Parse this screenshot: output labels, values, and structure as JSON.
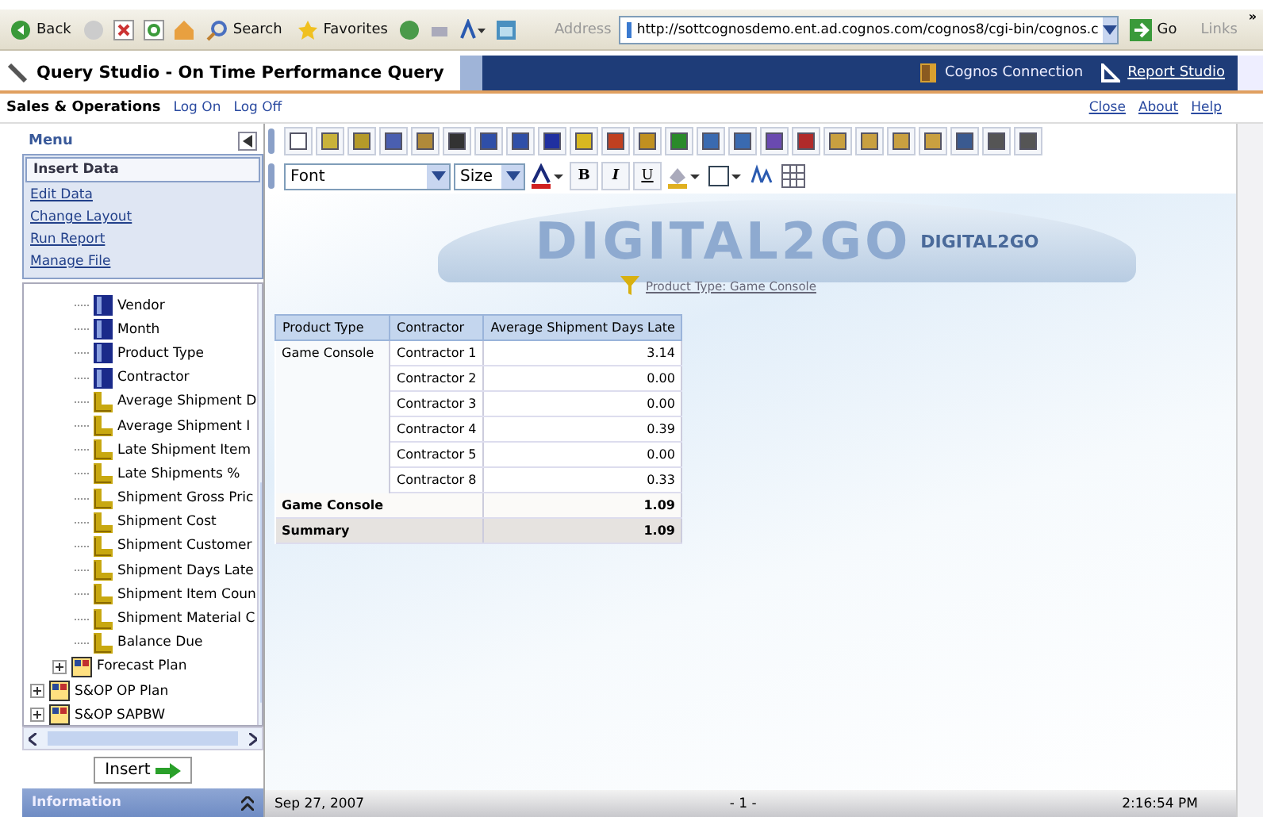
{
  "browser": {
    "back": "Back",
    "search": "Search",
    "favorites": "Favorites",
    "address_label": "Address",
    "url": "http://sottcognosdemo.ent.ad.cognos.com/cognos8/cgi-bin/cognos.c",
    "go": "Go",
    "links": "Links",
    "more": "»"
  },
  "app_bar": {
    "title": "Query Studio - On Time Performance Query",
    "cognos_connection": "Cognos Connection",
    "report_studio": "Report Studio"
  },
  "sub_bar": {
    "package": "Sales & Operations",
    "log_on": "Log On",
    "log_off": "Log Off",
    "links": [
      "Close",
      "About",
      "Help"
    ]
  },
  "menu": {
    "title": "Menu",
    "items": [
      {
        "label": "Insert Data",
        "selected": true
      },
      {
        "label": "Edit Data",
        "selected": false
      },
      {
        "label": "Change Layout",
        "selected": false
      },
      {
        "label": "Run Report",
        "selected": false
      },
      {
        "label": "Manage File",
        "selected": false
      }
    ]
  },
  "tree": [
    {
      "children": [
        {
          "children": [
            {
              "label": "Vendor",
              "kind": "level"
            },
            {
              "label": "Month",
              "kind": "level"
            },
            {
              "label": "Product Type",
              "kind": "level"
            },
            {
              "label": "Contractor",
              "kind": "level"
            },
            {
              "label": "Average Shipment D",
              "kind": "measure"
            },
            {
              "label": "Average Shipment I",
              "kind": "measure"
            },
            {
              "label": "Late Shipment Item",
              "kind": "measure"
            },
            {
              "label": "Late Shipments %",
              "kind": "measure"
            },
            {
              "label": "Shipment Gross Pric",
              "kind": "measure"
            },
            {
              "label": "Shipment Cost",
              "kind": "measure"
            },
            {
              "label": "Shipment Customer",
              "kind": "measure"
            },
            {
              "label": "Shipment Days Late",
              "kind": "measure"
            },
            {
              "label": "Shipment Item Coun",
              "kind": "measure"
            },
            {
              "label": "Shipment Material C",
              "kind": "measure"
            },
            {
              "label": "Balance Due",
              "kind": "measure"
            }
          ]
        },
        {
          "label": "Forecast Plan",
          "kind": "package",
          "expanded": false
        }
      ]
    },
    {
      "label": "S&OP OP Plan",
      "kind": "package",
      "expanded": false
    },
    {
      "label": "S&OP SAPBW",
      "kind": "package",
      "expanded": false
    }
  ],
  "insert_button": "Insert",
  "info_panel": {
    "title": "Information"
  },
  "toolbar": {
    "font": "Font",
    "size": "Size",
    "format_buttons": [
      "B",
      "I",
      "U"
    ]
  },
  "banner": {
    "logo": "DIGITAL2GO",
    "small_logo": "DIGITAL2GO"
  },
  "filter": "Product Type: Game Console",
  "table": {
    "columns": [
      "Product Type",
      "Contractor",
      "Average Shipment Days Late"
    ],
    "rows": [
      [
        "Game Console",
        "Contractor 1",
        "3.14"
      ],
      [
        "",
        "Contractor 2",
        "0.00"
      ],
      [
        "",
        "Contractor 3",
        "0.00"
      ],
      [
        "",
        "Contractor 4",
        "0.39"
      ],
      [
        "",
        "Contractor 5",
        "0.00"
      ],
      [
        "",
        "Contractor 8",
        "0.33"
      ]
    ],
    "subtotal": [
      "Game Console",
      "1.09"
    ],
    "summary": [
      "Summary",
      "1.09"
    ]
  },
  "status_bar": {
    "date": "Sep 27, 2007",
    "page": "- 1 -",
    "time": "2:16:54 PM"
  }
}
